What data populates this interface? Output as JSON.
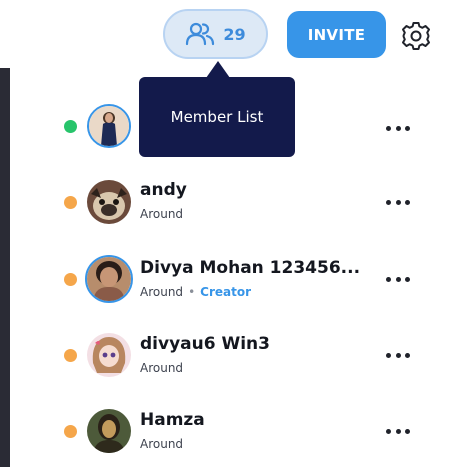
{
  "header": {
    "member_count": "29",
    "invite_label": "INVITE",
    "tooltip": "Member List"
  },
  "members": [
    {
      "name": "",
      "status": "",
      "role": "",
      "presence_color": "#27c46b"
    },
    {
      "name": "andy",
      "status": "Around",
      "role": "",
      "presence_color": "#f5a64a"
    },
    {
      "name": "Divya Mohan 123456...",
      "status": "Around",
      "role": "Creator",
      "presence_color": "#f5a64a"
    },
    {
      "name": "divyau6 Win3",
      "status": "Around",
      "role": "",
      "presence_color": "#f5a64a"
    },
    {
      "name": "Hamza",
      "status": "Around",
      "role": "",
      "presence_color": "#f5a64a"
    }
  ],
  "icons": {
    "members": "people-icon",
    "settings": "gear-icon",
    "row_menu": "more-horizontal-icon"
  },
  "colors": {
    "accent": "#3795e8",
    "online": "#27c46b",
    "away": "#f5a64a",
    "tooltip_bg": "#131a4b"
  }
}
